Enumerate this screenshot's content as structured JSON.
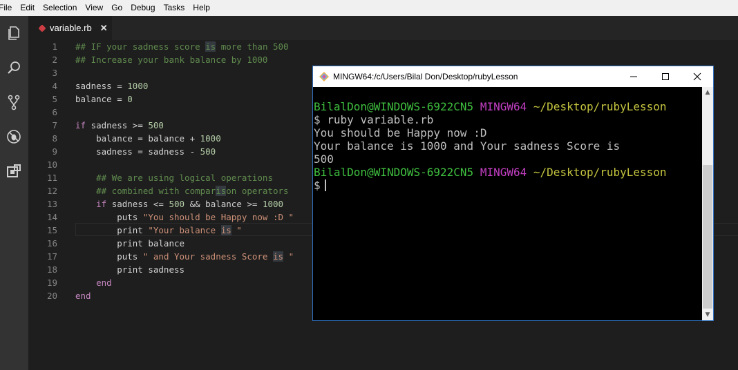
{
  "menu": [
    "File",
    "Edit",
    "Selection",
    "View",
    "Go",
    "Debug",
    "Tasks",
    "Help"
  ],
  "tab": {
    "filename": "variable.rb",
    "close": "✕"
  },
  "editor": {
    "line_numbers": [
      "1",
      "2",
      "3",
      "4",
      "5",
      "6",
      "7",
      "8",
      "9",
      "10",
      "11",
      "12",
      "13",
      "14",
      "15",
      "16",
      "17",
      "18",
      "19",
      "20"
    ]
  },
  "terminal": {
    "title": "MINGW64:/c/Users/Bilal Don/Desktop/rubyLesson",
    "user_host": "BilalDon@WINDOWS-6922CN5",
    "shell": "MINGW64",
    "path": "~/Desktop/rubyLesson",
    "prompt": "$",
    "command": "ruby variable.rb",
    "output": [
      "You should be Happy now :D",
      "Your balance is 1000 and Your sadness Score is",
      "500"
    ]
  }
}
